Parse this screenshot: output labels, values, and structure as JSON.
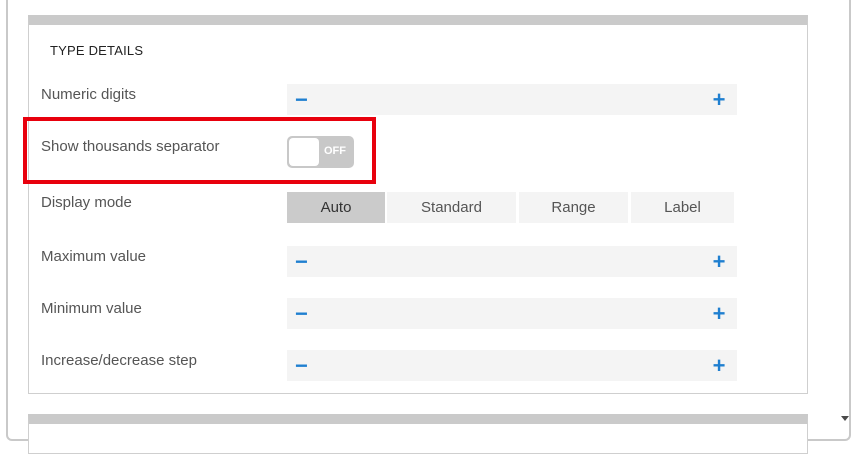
{
  "section": {
    "title": "TYPE DETAILS"
  },
  "fields": {
    "numeric_digits": {
      "label": "Numeric digits",
      "minus": "−",
      "plus": "+"
    },
    "thousands_separator": {
      "label": "Show thousands separator",
      "toggle_state": "OFF"
    },
    "display_mode": {
      "label": "Display mode",
      "options": [
        "Auto",
        "Standard",
        "Range",
        "Label"
      ],
      "selected": "Auto"
    },
    "maximum_value": {
      "label": "Maximum value",
      "minus": "−",
      "plus": "+"
    },
    "minimum_value": {
      "label": "Minimum value",
      "minus": "−",
      "plus": "+"
    },
    "step": {
      "label": "Increase/decrease step",
      "minus": "−",
      "plus": "+"
    }
  },
  "colors": {
    "accent": "#1f7fd0",
    "highlight": "#e8000d",
    "segment_active": "#cbcbcb",
    "segment_idle": "#f4f4f4"
  },
  "icons": {
    "scroll_down": "caret-down-icon"
  }
}
